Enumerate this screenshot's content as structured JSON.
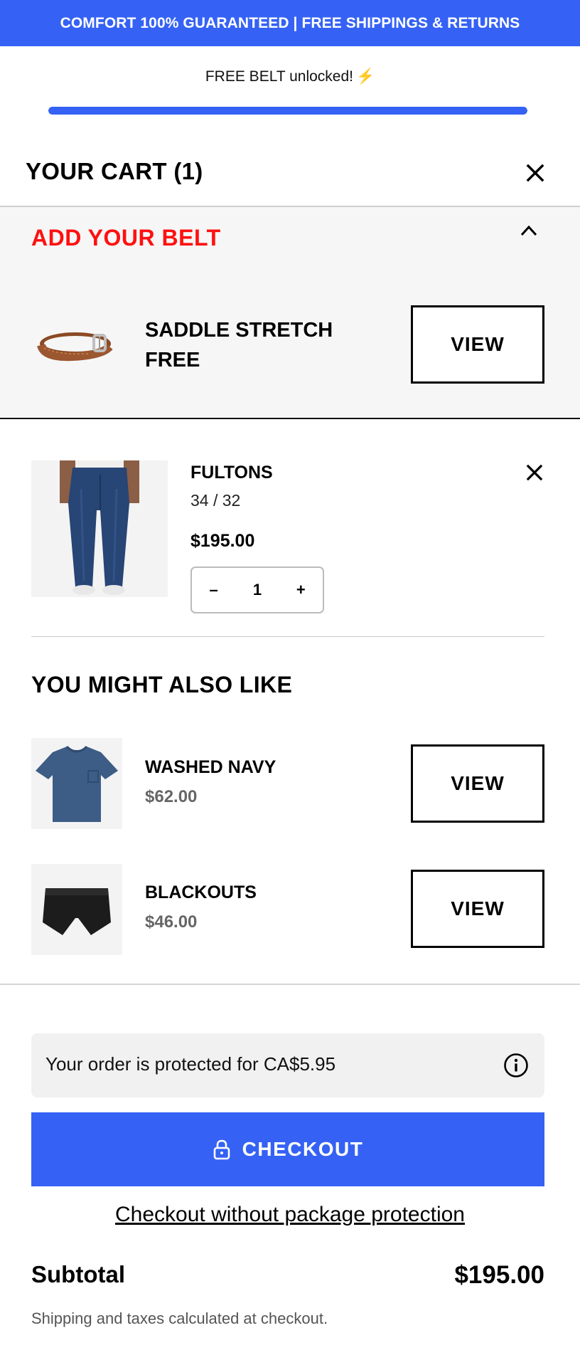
{
  "announcement": "COMFORT 100% GUARANTEED | FREE SHIPPINGS & RETURNS",
  "progress": {
    "message": "FREE BELT unlocked!",
    "icon": "lightning-icon",
    "icon_glyph": "⚡",
    "fill_percent": 100,
    "fill_color": "#3562f5"
  },
  "cart": {
    "title": "YOUR CART (1)",
    "close_icon": "close-icon"
  },
  "belt_offer": {
    "heading": "ADD YOUR BELT",
    "heading_color": "#ff1010",
    "toggle_icon": "chevron-up-icon",
    "product_line1": "SADDLE STRETCH",
    "product_line2": "FREE",
    "button_label": "VIEW"
  },
  "line_item": {
    "name": "FULTONS",
    "variant": "34 / 32",
    "price": "$195.00",
    "quantity": "1",
    "decrement": "–",
    "increment": "+",
    "remove_icon": "close-icon"
  },
  "recommendations": {
    "title": "YOU MIGHT ALSO LIKE",
    "items": [
      {
        "name": "WASHED NAVY",
        "price": "$62.00",
        "button_label": "VIEW"
      },
      {
        "name": "BLACKOUTS",
        "price": "$46.00",
        "button_label": "VIEW"
      }
    ]
  },
  "protection": {
    "text": "Your order is protected for CA$5.95",
    "icon": "info-icon"
  },
  "checkout": {
    "label": "CHECKOUT",
    "icon": "lock-icon",
    "accent": "#3562f5",
    "alt_link": "Checkout without package protection"
  },
  "summary": {
    "subtotal_label": "Subtotal",
    "subtotal_value": "$195.00",
    "note": "Shipping and taxes calculated at checkout."
  }
}
